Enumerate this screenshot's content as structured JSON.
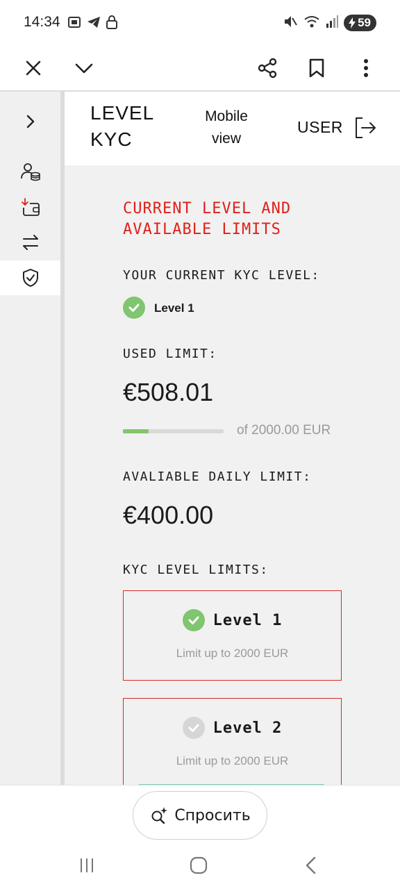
{
  "status_bar": {
    "time": "14:34",
    "battery": "59"
  },
  "browser_toolbar": {
    "buttons": [
      "close-icon",
      "chevron-down-icon",
      "share-icon",
      "bookmark-icon",
      "more-vertical-icon"
    ]
  },
  "sidebar": {
    "items": [
      {
        "icon": "chevron-right-icon"
      },
      {
        "icon": "user-coins-icon"
      },
      {
        "icon": "wallet-download-icon"
      },
      {
        "icon": "swap-arrows-icon"
      },
      {
        "icon": "shield-check-icon",
        "active": true
      }
    ]
  },
  "header": {
    "title_line1": "LEVEL",
    "title_line2": "KYC",
    "mobile_view_line1": "Mobile",
    "mobile_view_line2": "view",
    "user": "USER"
  },
  "main": {
    "section_title_line1": "CURRENT LEVEL AND",
    "section_title_line2": "AVAILABLE LIMITS",
    "current_level_label": "YOUR CURRENT KYC LEVEL:",
    "current_level_value": "Level 1",
    "used_limit_label": "USED LIMIT:",
    "used_limit_value": "€508.01",
    "used_progress_fraction": 0.254,
    "used_limit_total": "of 2000.00 EUR",
    "daily_limit_label": "AVALIABLE DAILY LIMIT:",
    "daily_limit_value": "€400.00",
    "kyc_limits_label": "KYC LEVEL LIMITS:",
    "levels": [
      {
        "name": "Level 1",
        "limit": "Limit up to 2000 EUR",
        "achieved": true
      },
      {
        "name": "Level 2",
        "limit": "Limit up to 2000 EUR",
        "achieved": false
      }
    ]
  },
  "ask": {
    "label": "Спросить"
  },
  "colors": {
    "accent_red": "#e0201b",
    "success_green": "#80c56f",
    "card_border": "#d42a2a"
  }
}
